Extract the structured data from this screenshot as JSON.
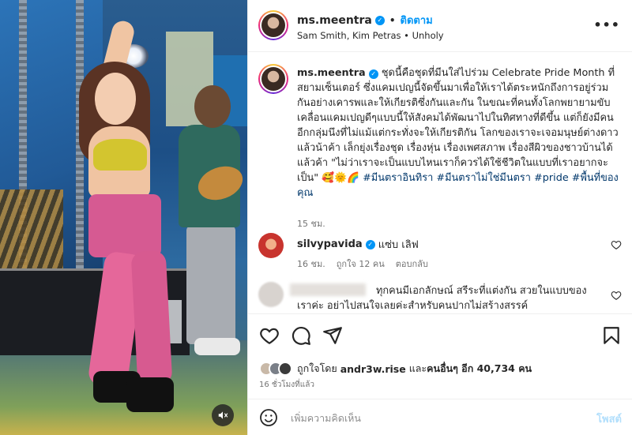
{
  "post": {
    "username": "ms.meentra",
    "follow_label": "ติดตาม",
    "audio": "Sam Smith, Kim Petras • Unholy",
    "more_icon": "more-icon"
  },
  "caption": {
    "username": "ms.meentra",
    "text": "ชุดนี้คือชุดที่มีนใส่ไปร่วม Celebrate Pride Month ที่สยามเซ็นเตอร์ ซึ่งแคมเปญนี้จัดขึ้นมาเพื่อให้เราได้ตระหนักถึงการอยู่ร่วมกันอย่างเคารพและให้เกียรติซึ่งกันและกัน ในขณะที่คนทั้งโลกพยายามขับเคลื่อนแคมเปญดีๆแบบนี้ให้สังคมได้พัฒนาไปในทิศทางที่ดีขึ้น แต่ก็ยังมีคนอีกกลุ่มนึงที่ไม่แม้แต่กระทั่งจะให้เกียรติกัน โลกของเราจะเจอมนุษย์ต่างดาวแล้วน้าค้า เล็กยุ่งเรื่องชุด เรื่องหุ่น เรื่องเพศสภาพ เรื่องสีผิวของชาวบ้านได้แล้วค้า \"ไม่ว่าเราจะเป็นแบบไหนเราก็ควรได้ใช้ชีวิตในแบบที่เราอยากจะเป็น\" 🥰🌞🌈",
    "hashtags": "#มีนตราอินทิรา #มีนตราไม่ใช่มีนตรา #pride #พื้นที่ของคุณ",
    "time": "15 ชม."
  },
  "comment1": {
    "username": "silvypavida",
    "text": "แซ่บ เลิฟ",
    "time": "16 ชม.",
    "likes": "ถูกใจ 12 คน",
    "reply": "ตอบกลับ"
  },
  "comment2": {
    "text": "ทุกคนมีเอกลักษณ์ สรีระที่แต่งกัน สวยในแบบของเราค่ะ อย่าไปสนใจเลยค่ะสำหรับคนปากไม่สร้างสรรค์"
  },
  "likes": {
    "prefix": "ถูกใจโดย",
    "user": "andr3w.rise",
    "middle": "และ",
    "others": "คนอื่นๆ อีก 40,734 คน"
  },
  "post_time": "16 ชั่วโมงที่แล้ว",
  "add_comment": {
    "placeholder": "เพิ่มความคิดเห็น",
    "post_label": "โพสต์"
  },
  "colors": {
    "accent": "#0095f6",
    "hashtag": "#00376b",
    "muted": "#737373"
  }
}
